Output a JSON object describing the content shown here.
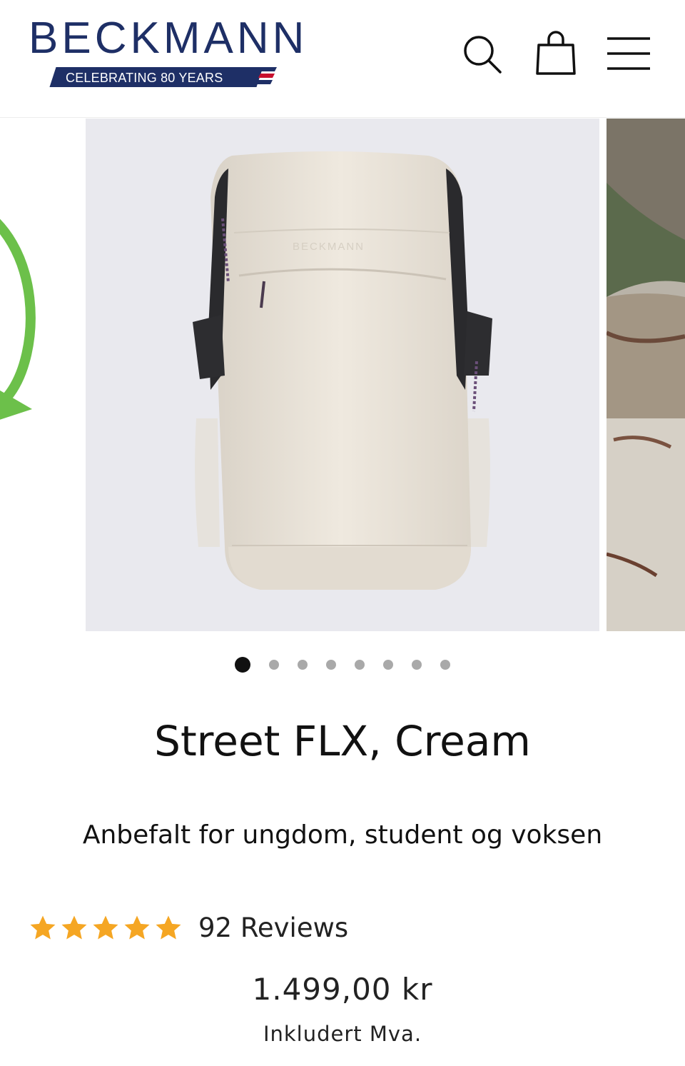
{
  "header": {
    "brand": "BECKMANN",
    "ribbon": "CELEBRATING 80 YEARS",
    "icons": [
      "search-icon",
      "shopping-bag-icon",
      "hamburger-menu-icon"
    ]
  },
  "carousel": {
    "current_index": 1,
    "total_slides": 8,
    "images": [
      "product-image-backpack-cream",
      "lifestyle-image-beach"
    ],
    "bag_print": "BECKMANN"
  },
  "product": {
    "title": "Street FLX, Cream",
    "subtitle": "Anbefalt for ungdom, student og voksen",
    "rating_stars": 5,
    "reviews": "92 Reviews",
    "price": "1.499,00 kr",
    "vat_note": "Inkludert Mva."
  },
  "colors": {
    "brand_navy": "#1e2f66",
    "star": "#f5a623",
    "accent_green": "#6cc04a",
    "dot_active": "#111111",
    "dot_inactive": "#a9a9a9"
  }
}
